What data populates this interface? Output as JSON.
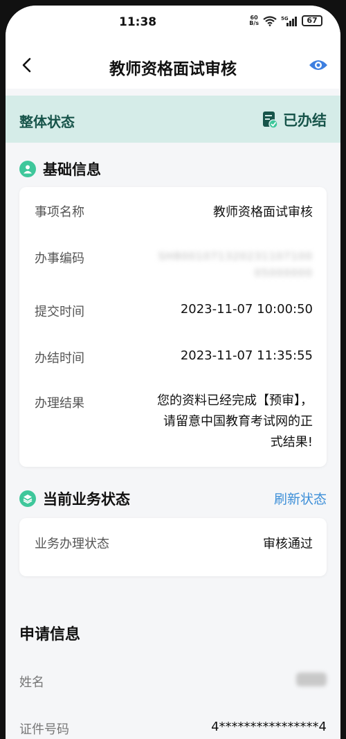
{
  "status_bar": {
    "time": "11:38",
    "net_speed_value": "60",
    "net_speed_unit": "B/s",
    "network": "5G",
    "battery": "67"
  },
  "header": {
    "title": "教师资格面试审核",
    "back_icon": "chevron-left-icon",
    "eye_icon": "eye-icon"
  },
  "overall": {
    "label": "整体状态",
    "value": "已办结",
    "icon": "doc-check-icon"
  },
  "basic_info": {
    "title": "基础信息",
    "rows": [
      {
        "label": "事项名称",
        "value": "教师资格面试审核"
      },
      {
        "label": "办事编码",
        "value": "SH800107132023110710005000000"
      },
      {
        "label": "提交时间",
        "value": "2023-11-07 10:00:50"
      },
      {
        "label": "办结时间",
        "value": "2023-11-07 11:35:55"
      },
      {
        "label": "办理结果",
        "value": "您的资料已经完成【预审】，请留意中国教育考试网的正式结果!"
      }
    ]
  },
  "business_status": {
    "title": "当前业务状态",
    "refresh_label": "刷新状态",
    "rows": [
      {
        "label": "业务办理状态",
        "value": "审核通过"
      }
    ]
  },
  "apply_info": {
    "title": "申请信息",
    "rows": [
      {
        "label": "姓名",
        "value": ""
      },
      {
        "label": "证件号码",
        "value": "4****************4"
      }
    ]
  },
  "colors": {
    "accent_green": "#3fc79b",
    "status_bg": "#d5ece8",
    "status_text": "#17544a",
    "link_blue": "#3d8fd8",
    "eye_blue": "#3d7fe0"
  }
}
